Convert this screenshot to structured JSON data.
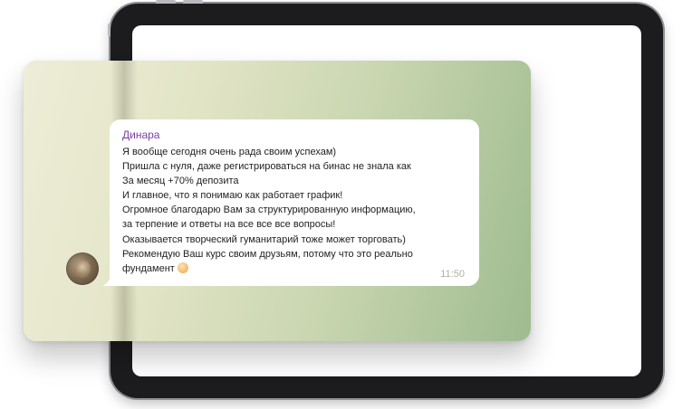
{
  "message": {
    "sender": "Динара",
    "lines": [
      "Я вообще сегодня очень рада своим успехам)",
      "Пришла с нуля, даже регистрироваться на бинас не знала как",
      "За месяц +70% депозита",
      "И главное, что я понимаю как работает график!",
      "Огромное благодарю Вам за структурированную информацию,",
      "за терпение и ответы на все все все вопросы!",
      "Оказывается творческий гуманитарий тоже может торговать)",
      "Рекомендую Ваш курс своим друзьям, потому что это реально",
      "фундамент"
    ],
    "emoji": "ok-hand-emoji",
    "time": "11:50"
  },
  "colors": {
    "sender_name": "#7b3fa6",
    "bubble": "#ffffff",
    "chat_bg_start": "#eeedd8",
    "chat_bg_end": "#9fbb90",
    "tablet_frame": "#1c1c1e"
  }
}
